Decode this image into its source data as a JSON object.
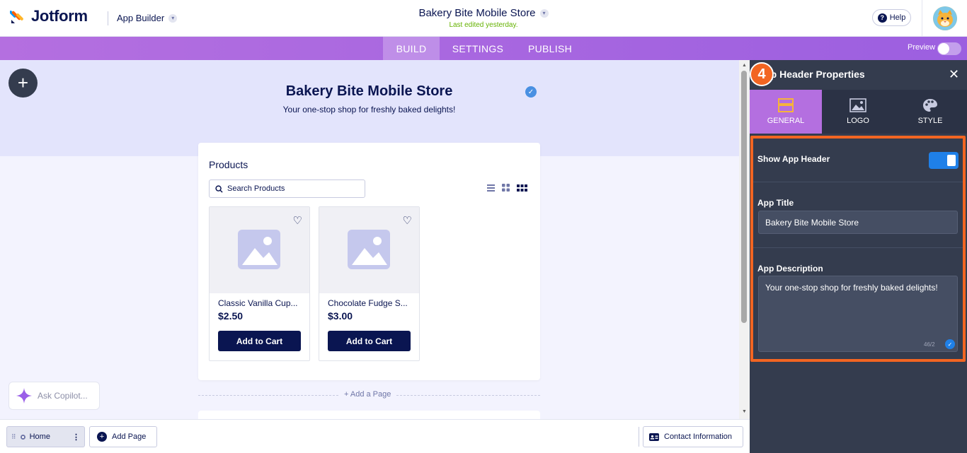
{
  "topbar": {
    "brand": "Jotform",
    "app_builder_label": "App Builder",
    "title": "Bakery Bite Mobile Store",
    "last_edited": "Last edited yesterday.",
    "help_label": "Help"
  },
  "nav": {
    "tabs": [
      {
        "label": "BUILD",
        "active": true
      },
      {
        "label": "SETTINGS",
        "active": false
      },
      {
        "label": "PUBLISH",
        "active": false
      }
    ],
    "preview_label": "Preview"
  },
  "app_header": {
    "title": "Bakery Bite Mobile Store",
    "description": "Your one-stop shop for freshly baked delights!"
  },
  "products": {
    "heading": "Products",
    "search_placeholder": "Search Products",
    "items": [
      {
        "name": "Classic Vanilla Cup...",
        "price": "$2.50",
        "button": "Add to Cart"
      },
      {
        "name": "Chocolate Fudge S...",
        "price": "$3.00",
        "button": "Add to Cart"
      }
    ]
  },
  "add_page_divider": "Add a Page",
  "copilot_label": "Ask Copilot...",
  "panel": {
    "title": "App Header Properties",
    "tabs": [
      {
        "label": "GENERAL",
        "active": true
      },
      {
        "label": "LOGO",
        "active": false
      },
      {
        "label": "STYLE",
        "active": false
      }
    ],
    "step_badge": "4",
    "show_header_label": "Show App Header",
    "show_header_on": true,
    "app_title_label": "App Title",
    "app_title_value": "Bakery Bite Mobile Store",
    "app_desc_label": "App Description",
    "app_desc_value": "Your one-stop shop for freshly baked delights!",
    "char_count": "46/2"
  },
  "footer": {
    "home_label": "Home",
    "add_page_label": "Add Page",
    "contact_label": "Contact Information"
  },
  "colors": {
    "navy": "#0a1551",
    "purple": "#b46fe0",
    "panel_bg": "#343c4e",
    "highlight": "#f26522",
    "toggle_blue": "#1f80e8"
  }
}
